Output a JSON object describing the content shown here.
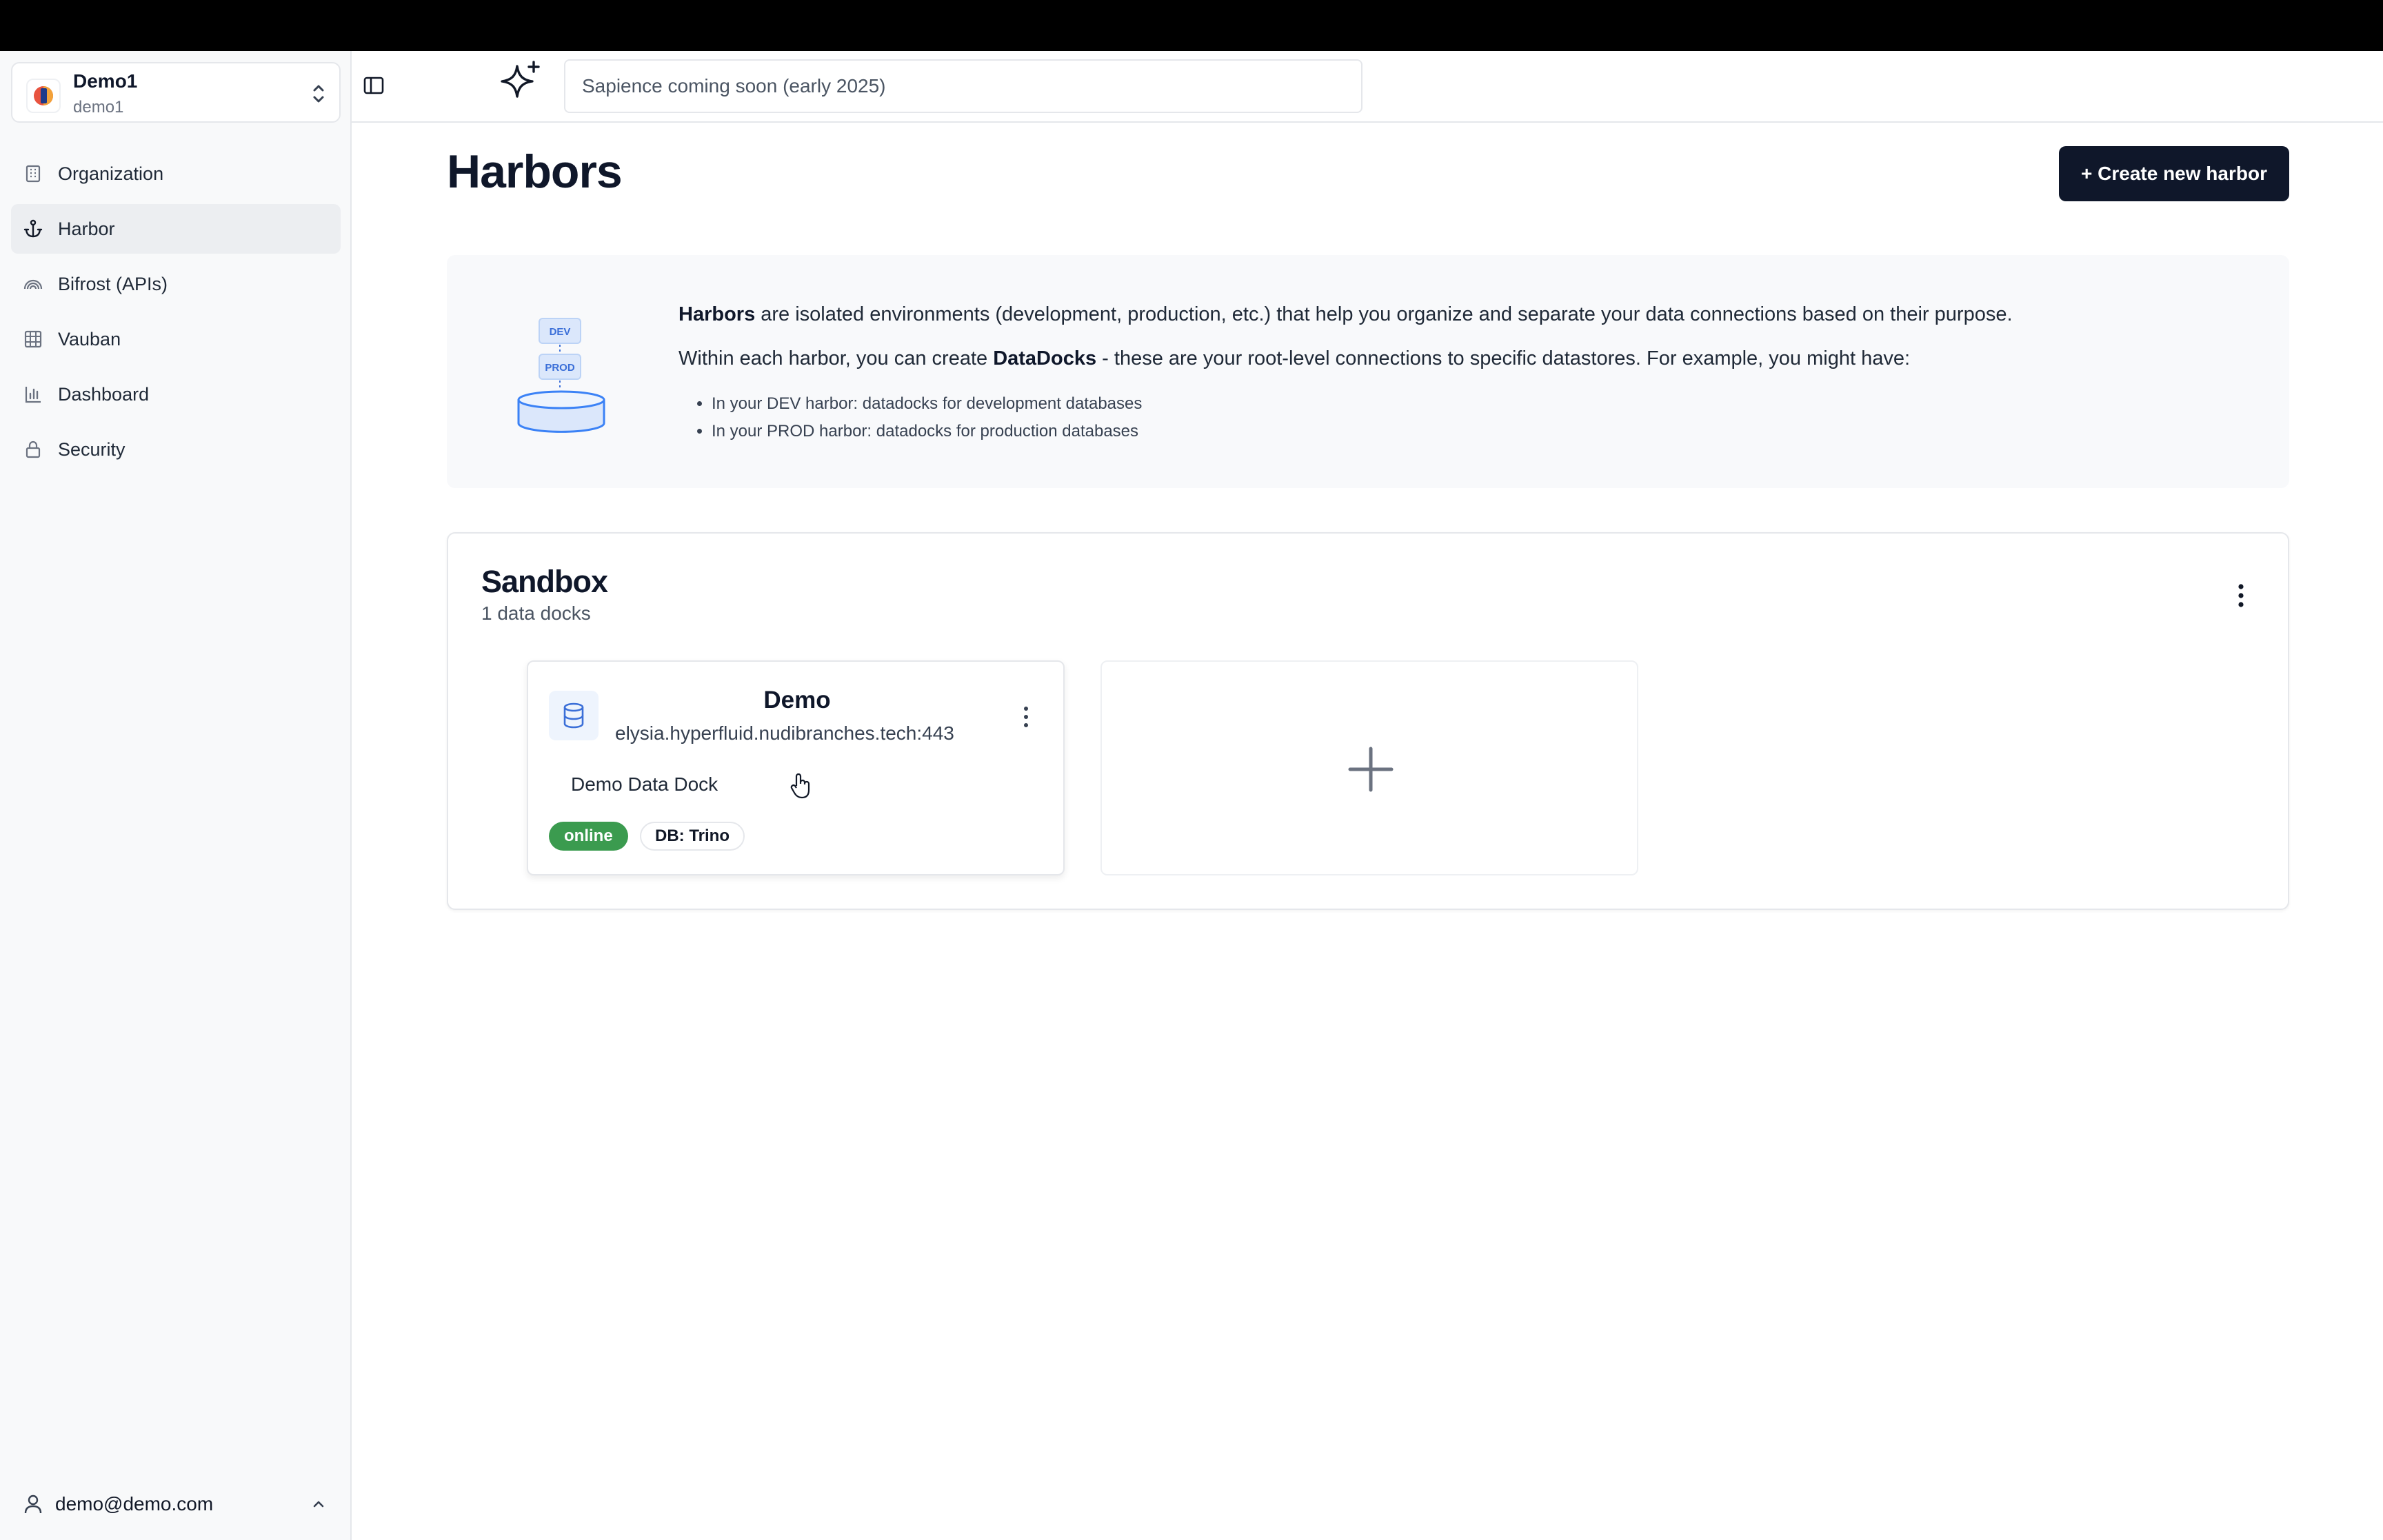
{
  "org": {
    "name": "Demo1",
    "slug": "demo1"
  },
  "sidebar": {
    "items": [
      {
        "label": "Organization",
        "icon": "building-icon"
      },
      {
        "label": "Harbor",
        "icon": "anchor-icon",
        "active": true
      },
      {
        "label": "Bifrost (APIs)",
        "icon": "rainbow-icon"
      },
      {
        "label": "Vauban",
        "icon": "grid-icon"
      },
      {
        "label": "Dashboard",
        "icon": "bar-chart-icon"
      },
      {
        "label": "Security",
        "icon": "lock-icon"
      }
    ],
    "user_email": "demo@demo.com"
  },
  "header": {
    "sapience_placeholder": "Sapience coming soon (early 2025)"
  },
  "page": {
    "title": "Harbors",
    "create_button": "+ Create new harbor"
  },
  "info": {
    "p1_bold": "Harbors",
    "p1_rest": " are isolated environments (development, production, etc.) that help you organize and separate your data connections based on their purpose.",
    "p2_start": "Within each harbor, you can create ",
    "p2_bold": "DataDocks",
    "p2_rest": " - these are your root-level connections to specific datastores. For example, you might have:",
    "bullets": [
      "In your DEV harbor: datadocks for development databases",
      "In your PROD harbor: datadocks for production databases"
    ],
    "illustration": {
      "label_top": "DEV",
      "label_bottom": "PROD"
    }
  },
  "harbor": {
    "name": "Sandbox",
    "count": "1 data docks",
    "docks": [
      {
        "title": "Demo",
        "host": "elysia.hyperfluid.nudibranches.tech:443",
        "description": "Demo Data Dock",
        "status": "online",
        "db": "DB: Trino"
      }
    ]
  },
  "colors": {
    "primary": "#0f172a",
    "online": "#3b9b4f",
    "accent_blue": "#3b82f6"
  }
}
